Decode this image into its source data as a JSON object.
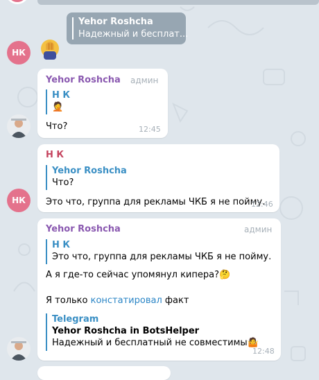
{
  "pinned": {
    "name": "Yehor Roshcha",
    "text": "Надежный и бесплат..."
  },
  "avatars": {
    "nk": "НК"
  },
  "messages": [
    {
      "sender": "Yehor Roshcha",
      "role": "админ",
      "reply_name": "Н К",
      "reply_emoji": "🤦",
      "text": "Что?",
      "time": "12:45"
    },
    {
      "sender": "Н К",
      "reply_name": "Yehor Roshcha",
      "reply_text": "Что?",
      "text": "Это что, группа для рекламы ЧКБ я не пойму.",
      "time": "12:46"
    },
    {
      "sender": "Yehor Roshcha",
      "role": "админ",
      "reply_name": "Н К",
      "reply_text": "Это что, группа для рекламы ЧКБ я не пойму.",
      "line1": "А я где-то сейчас упомянул кипера?🤔",
      "line2_before": "Я только ",
      "line2_link": "констатировал",
      "line2_after": " факт",
      "forward_source": "Telegram",
      "forward_title": "Yehor Roshcha in BotsHelper",
      "forward_text": "Надежный и бесплатный не совместимы🤷",
      "time": "12:48"
    }
  ],
  "colors": {
    "background": "#dfe6ec",
    "accent_blue": "#3a8fc4",
    "sender_purple": "#8a59b0",
    "sender_red": "#c5445f",
    "avatar_pink": "#e4728c"
  }
}
